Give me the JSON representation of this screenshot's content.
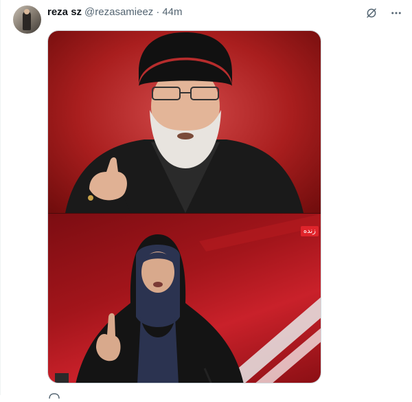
{
  "post": {
    "author_name": "reza sz",
    "handle": "@rezasamieez",
    "separator": "·",
    "time": "44m"
  },
  "top_icons": [
    "grok-icon",
    "more-icon"
  ],
  "media": {
    "live_badge": "زنده"
  },
  "colors": {
    "text_primary": "#0f1419",
    "text_secondary": "#536471",
    "live_badge": "#e0242b"
  }
}
